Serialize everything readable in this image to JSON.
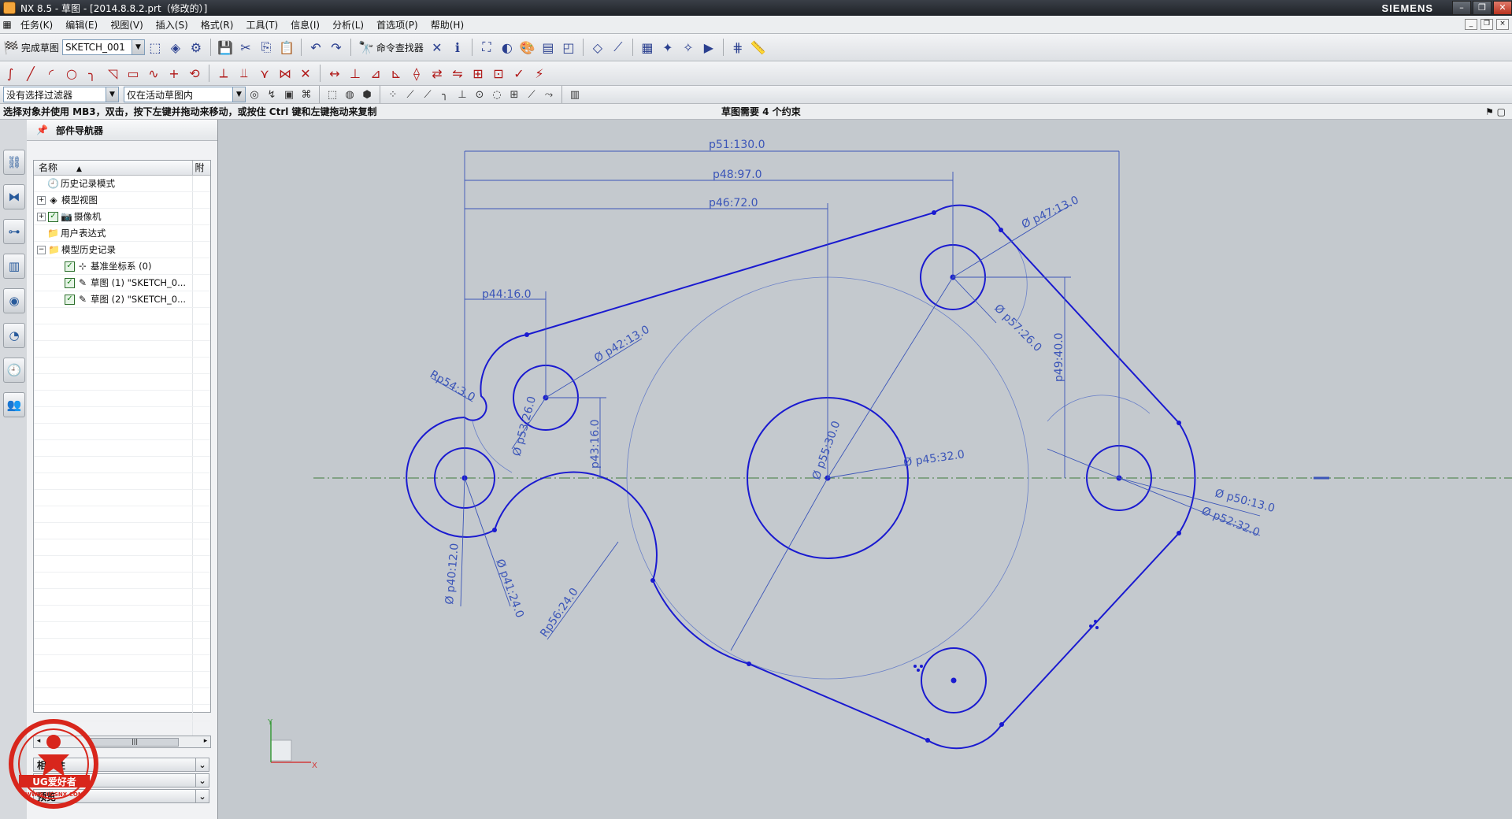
{
  "titlebar": {
    "title": "NX 8.5 - 草图 - [2014.8.8.2.prt（修改的）]",
    "brand": "SIEMENS",
    "controls": [
      "–",
      "❐",
      "✕"
    ]
  },
  "menubar": {
    "items": [
      "任务(K)",
      "编辑(E)",
      "视图(V)",
      "插入(S)",
      "格式(R)",
      "工具(T)",
      "信息(I)",
      "分析(L)",
      "首选项(P)",
      "帮助(H)"
    ]
  },
  "toolbar1": {
    "finish_sketch": "完成草图",
    "sketch_name": "SKETCH_001",
    "command_finder": "命令查找器"
  },
  "toolbar3": {
    "selection_filter": "没有选择过滤器",
    "scope": "仅在活动草图内"
  },
  "status": {
    "prompt": "选择对象并使用 MB3，双击，按下左键并拖动来移动，或按住 Ctrl 键和左键拖动来复制",
    "constraints": "草图需要 4 个约束"
  },
  "navigator": {
    "title": "部件导航器",
    "columns": {
      "name": "名称",
      "attach": "附"
    },
    "rows": [
      {
        "label": "历史记录模式",
        "icon": "clock-icon",
        "indent": 0,
        "expander": "",
        "check": false
      },
      {
        "label": "模型视图",
        "icon": "model-views-icon",
        "indent": 0,
        "expander": "+",
        "check": false
      },
      {
        "label": "摄像机",
        "icon": "camera-icon",
        "indent": 0,
        "expander": "+",
        "check": true
      },
      {
        "label": "用户表达式",
        "icon": "folder-icon",
        "indent": 0,
        "expander": "",
        "check": false
      },
      {
        "label": "模型历史记录",
        "icon": "folder-icon",
        "indent": 0,
        "expander": "−",
        "check": false
      },
      {
        "label": "基准坐标系 (0)",
        "icon": "datum-csys-icon",
        "indent": 1,
        "expander": "",
        "check": true
      },
      {
        "label": "草图 (1) \"SKETCH_0...",
        "icon": "sketch-icon",
        "indent": 1,
        "expander": "",
        "check": true
      },
      {
        "label": "草图 (2) \"SKETCH_0...",
        "icon": "sketch-icon",
        "indent": 1,
        "expander": "",
        "check": true
      }
    ],
    "bottom_panels": [
      "相依性",
      "细节",
      "预览"
    ]
  },
  "dimensions": {
    "p51": "p51:130.0",
    "p48": "p48:97.0",
    "p46": "p46:72.0",
    "p47": "Ø p47:13.0",
    "p44": "p44:16.0",
    "p42": "Ø p42:13.0",
    "p54": "Rp54:3.0",
    "p53": "Ø p53:26.0",
    "p43": "p43:16.0",
    "p55": "Ø p55:30.0",
    "p45": "Ø p45:32.0",
    "p57": "Ø p57:26.0",
    "p49": "p49:40.0",
    "p50": "Ø p50:13.0",
    "p52": "Ø p52:32.0",
    "p40": "Ø p40:12.0",
    "p41": "Ø p41:24.0",
    "p56": "Rp56:24.0"
  },
  "axis_labels": {
    "x": "X",
    "y": "Y"
  },
  "watermark": {
    "brand": "UG爱好者",
    "url": "WWW.UGSNX.COM"
  },
  "colors": {
    "sketch_curve": "#1a1ad0",
    "dimension": "#3b55b8",
    "background": "#c4c9ce",
    "centerline": "#5a8a5a"
  }
}
